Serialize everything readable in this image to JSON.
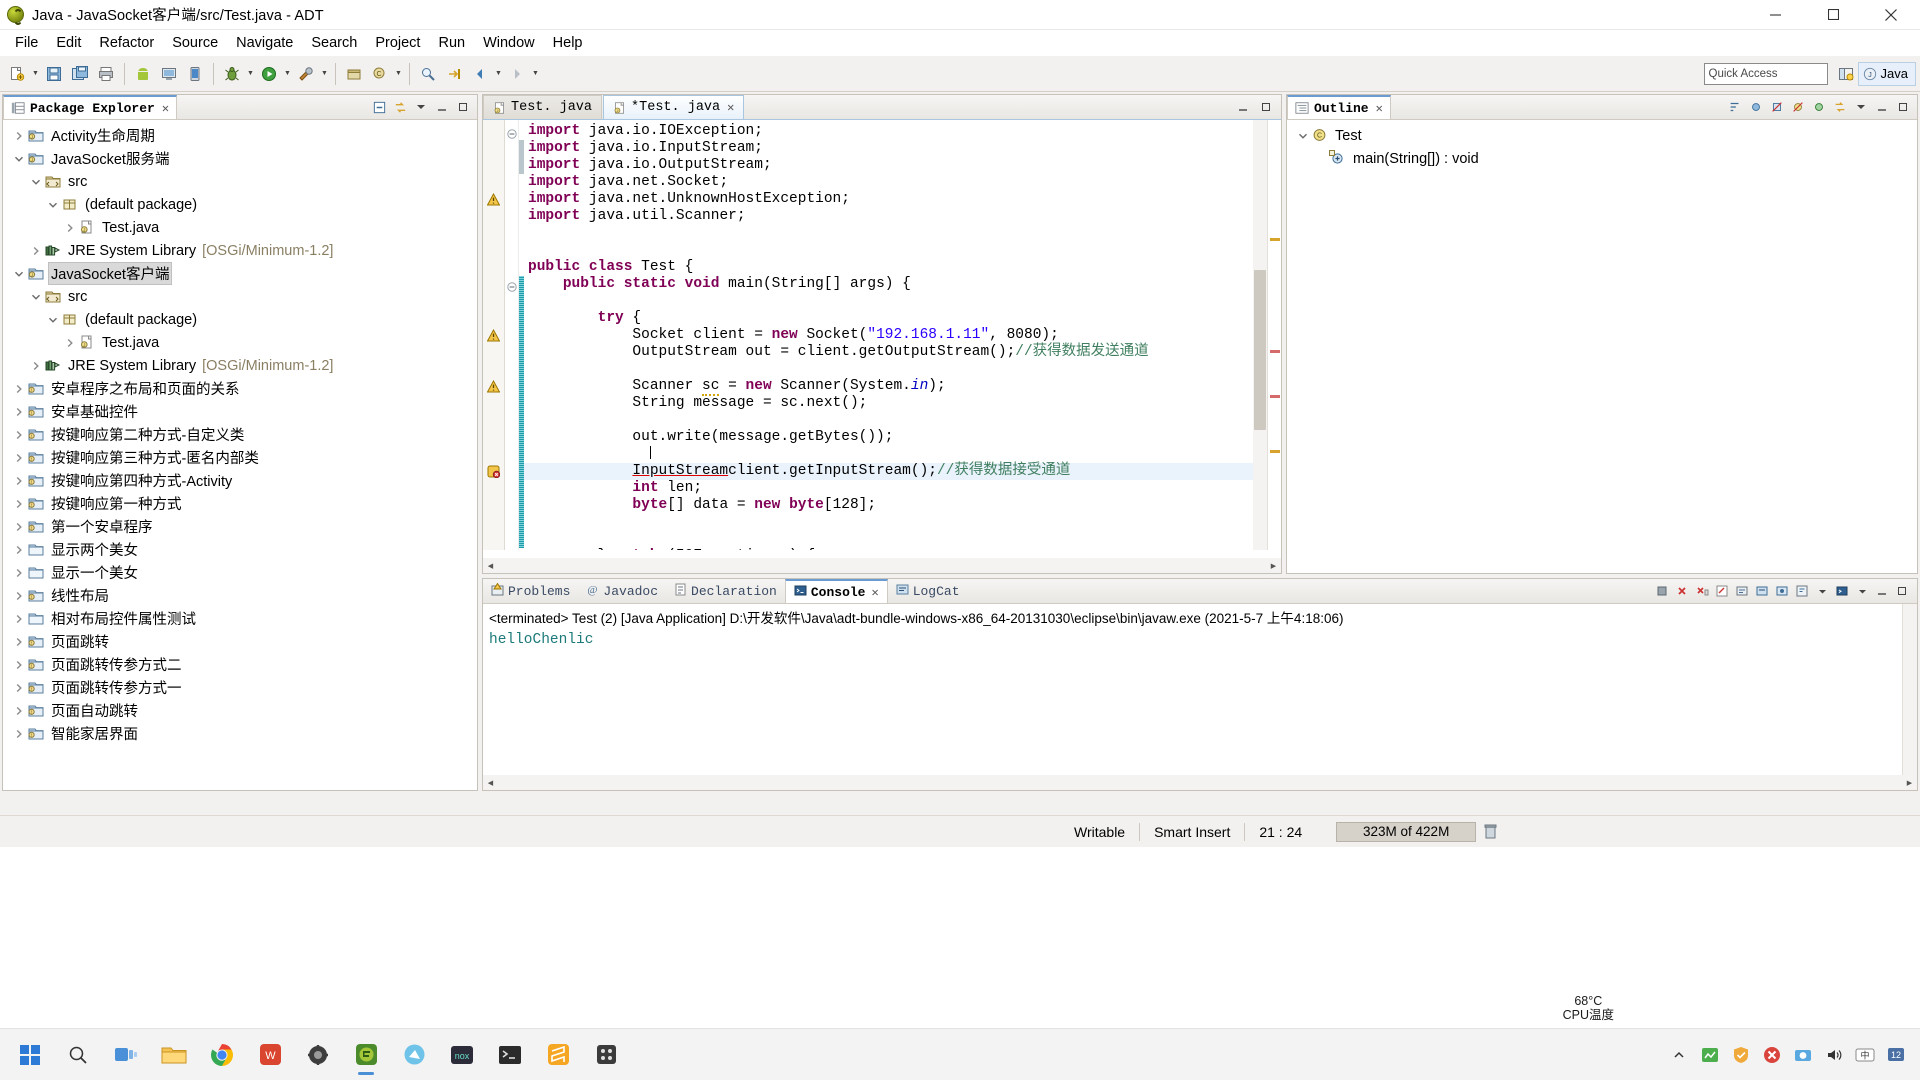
{
  "window": {
    "title": "Java - JavaSocket客户端/src/Test.java - ADT",
    "minimize_label": "Minimize",
    "maximize_label": "Maximize",
    "close_label": "Close"
  },
  "menubar": {
    "items": [
      {
        "label": "File"
      },
      {
        "label": "Edit"
      },
      {
        "label": "Refactor"
      },
      {
        "label": "Source"
      },
      {
        "label": "Navigate"
      },
      {
        "label": "Search"
      },
      {
        "label": "Project"
      },
      {
        "label": "Run"
      },
      {
        "label": "Window"
      },
      {
        "label": "Help"
      }
    ]
  },
  "toolbar": {
    "quick_access_placeholder": "Quick Access",
    "perspective_java_label": "Java"
  },
  "package_explorer": {
    "title": "Package Explorer",
    "close_glyph": "✕",
    "tree": [
      {
        "label": "Activity生命周期",
        "indent": 0,
        "twisty": "collapsed",
        "icon": "java-project-icon"
      },
      {
        "label": "JavaSocket服务端",
        "indent": 0,
        "twisty": "expanded",
        "icon": "java-project-icon"
      },
      {
        "label": "src",
        "indent": 1,
        "twisty": "expanded",
        "icon": "source-folder-icon"
      },
      {
        "label": "(default package)",
        "indent": 2,
        "twisty": "expanded",
        "icon": "package-icon"
      },
      {
        "label": "Test.java",
        "indent": 3,
        "twisty": "collapsed",
        "icon": "java-file-icon"
      },
      {
        "label": "JRE System Library",
        "suffix": "[OSGi/Minimum-1.2]",
        "indent": 1,
        "twisty": "collapsed",
        "icon": "library-icon"
      },
      {
        "label": "JavaSocket客户端",
        "indent": 0,
        "twisty": "expanded",
        "icon": "java-project-icon",
        "selected": true
      },
      {
        "label": "src",
        "indent": 1,
        "twisty": "expanded",
        "icon": "source-folder-icon"
      },
      {
        "label": "(default package)",
        "indent": 2,
        "twisty": "expanded",
        "icon": "package-icon"
      },
      {
        "label": "Test.java",
        "indent": 3,
        "twisty": "collapsed",
        "icon": "java-file-icon"
      },
      {
        "label": "JRE System Library",
        "suffix": "[OSGi/Minimum-1.2]",
        "indent": 1,
        "twisty": "collapsed",
        "icon": "library-icon"
      },
      {
        "label": "安卓程序之布局和页面的关系",
        "indent": 0,
        "twisty": "collapsed",
        "icon": "android-project-icon"
      },
      {
        "label": "安卓基础控件",
        "indent": 0,
        "twisty": "collapsed",
        "icon": "android-project-icon"
      },
      {
        "label": "按键响应第二种方式-自定义类",
        "indent": 0,
        "twisty": "collapsed",
        "icon": "android-project-icon"
      },
      {
        "label": "按键响应第三种方式-匿名内部类",
        "indent": 0,
        "twisty": "collapsed",
        "icon": "android-project-icon"
      },
      {
        "label": "按键响应第四种方式-Activity",
        "indent": 0,
        "twisty": "collapsed",
        "icon": "android-project-icon"
      },
      {
        "label": "按键响应第一种方式",
        "indent": 0,
        "twisty": "collapsed",
        "icon": "android-project-icon"
      },
      {
        "label": "第一个安卓程序",
        "indent": 0,
        "twisty": "collapsed",
        "icon": "android-project-icon"
      },
      {
        "label": "显示两个美女",
        "indent": 0,
        "twisty": "collapsed",
        "icon": "closed-project-icon"
      },
      {
        "label": "显示一个美女",
        "indent": 0,
        "twisty": "collapsed",
        "icon": "closed-project-icon"
      },
      {
        "label": "线性布局",
        "indent": 0,
        "twisty": "collapsed",
        "icon": "android-project-icon"
      },
      {
        "label": "相对布局控件属性测试",
        "indent": 0,
        "twisty": "collapsed",
        "icon": "closed-project-icon"
      },
      {
        "label": "页面跳转",
        "indent": 0,
        "twisty": "collapsed",
        "icon": "android-project-icon"
      },
      {
        "label": "页面跳转传参方式二",
        "indent": 0,
        "twisty": "collapsed",
        "icon": "android-project-icon"
      },
      {
        "label": "页面跳转传参方式一",
        "indent": 0,
        "twisty": "collapsed",
        "icon": "android-project-icon"
      },
      {
        "label": "页面自动跳转",
        "indent": 0,
        "twisty": "collapsed",
        "icon": "android-project-icon"
      },
      {
        "label": "智能家居界面",
        "indent": 0,
        "twisty": "collapsed",
        "icon": "android-project-icon"
      }
    ]
  },
  "editor": {
    "tabs": [
      {
        "label": "Test. java",
        "active": false,
        "dirty": false
      },
      {
        "label": "*Test. java",
        "active": true,
        "dirty": true,
        "close_glyph": "✕"
      }
    ],
    "code_lines": [
      {
        "text": "import java.io.IOException;",
        "fold": "start",
        "parts": [
          {
            "t": "import",
            "c": "kw"
          },
          {
            "t": " java.io.IOException;",
            "c": ""
          }
        ]
      },
      {
        "text": "import java.io.InputStream;",
        "parts": [
          {
            "t": "import",
            "c": "kw"
          },
          {
            "t": " java.io.InputStream;",
            "c": ""
          }
        ]
      },
      {
        "text": "import java.io.OutputStream;",
        "parts": [
          {
            "t": "import",
            "c": "kw"
          },
          {
            "t": " java.io.OutputStream;",
            "c": ""
          }
        ]
      },
      {
        "text": "import java.net.Socket;",
        "parts": [
          {
            "t": "import",
            "c": "kw"
          },
          {
            "t": " java.net.Socket;",
            "c": ""
          }
        ]
      },
      {
        "text": "import java.net.UnknownHostException;",
        "marker": "warning",
        "parts": [
          {
            "t": "import",
            "c": "kw"
          },
          {
            "t": " java.net.UnknownHostException;",
            "c": ""
          }
        ]
      },
      {
        "text": "import java.util.Scanner;",
        "parts": [
          {
            "t": "import",
            "c": "kw"
          },
          {
            "t": " java.util.Scanner;",
            "c": ""
          }
        ]
      },
      {
        "text": "",
        "parts": []
      },
      {
        "text": "",
        "parts": []
      },
      {
        "text": "public class Test {",
        "parts": [
          {
            "t": "public class",
            "c": "kw"
          },
          {
            "t": " Test {",
            "c": ""
          }
        ]
      },
      {
        "text": "    public static void main(String[] args) {",
        "fold": "start",
        "parts": [
          {
            "t": "    ",
            "c": ""
          },
          {
            "t": "public static void",
            "c": "kw"
          },
          {
            "t": " main(String[] args) {",
            "c": ""
          }
        ]
      },
      {
        "text": "",
        "parts": []
      },
      {
        "text": "        try {",
        "parts": [
          {
            "t": "        ",
            "c": ""
          },
          {
            "t": "try",
            "c": "kw"
          },
          {
            "t": " {",
            "c": ""
          }
        ]
      },
      {
        "text": "            Socket client = new Socket(\"192.168.1.11\", 8080);",
        "marker": "warning",
        "parts": [
          {
            "t": "            Socket client = ",
            "c": ""
          },
          {
            "t": "new",
            "c": "kw"
          },
          {
            "t": " Socket(",
            "c": ""
          },
          {
            "t": "\"192.168.1.11\"",
            "c": "str"
          },
          {
            "t": ", 8080);",
            "c": ""
          }
        ]
      },
      {
        "text": "            OutputStream out = client.getOutputStream();//获得数据发送通道",
        "parts": [
          {
            "t": "            OutputStream out = client.getOutputStream();",
            "c": ""
          },
          {
            "t": "//获得数据发送通道",
            "c": "cmt"
          }
        ]
      },
      {
        "text": "",
        "parts": []
      },
      {
        "text": "            Scanner sc = new Scanner(System.in);",
        "marker": "warning",
        "parts": [
          {
            "t": "            Scanner ",
            "c": ""
          },
          {
            "t": "sc",
            "c": "warnu"
          },
          {
            "t": " = ",
            "c": ""
          },
          {
            "t": "new",
            "c": "kw"
          },
          {
            "t": " Scanner(System.",
            "c": ""
          },
          {
            "t": "in",
            "c": "fld"
          },
          {
            "t": ");",
            "c": ""
          }
        ]
      },
      {
        "text": "            String message = sc.next();",
        "parts": [
          {
            "t": "            String message = sc.next();",
            "c": ""
          }
        ]
      },
      {
        "text": "",
        "parts": []
      },
      {
        "text": "            out.write(message.getBytes());",
        "parts": [
          {
            "t": "            out.write(message.getBytes());",
            "c": ""
          }
        ]
      },
      {
        "text": "",
        "parts": [],
        "caret_line": true
      },
      {
        "text": "            InputStreamclient.getInputStream();//获得数据接受通道",
        "marker": "error",
        "highlight": true,
        "parts": [
          {
            "t": "            ",
            "c": ""
          },
          {
            "t": "InputStream",
            "c": "erru"
          },
          {
            "t": "client.getInputStream();",
            "c": ""
          },
          {
            "t": "//获得数据接受通道",
            "c": "cmt"
          }
        ]
      },
      {
        "text": "            int len;",
        "parts": [
          {
            "t": "            ",
            "c": ""
          },
          {
            "t": "int",
            "c": "kw"
          },
          {
            "t": " len;",
            "c": ""
          }
        ]
      },
      {
        "text": "            byte[] data = new byte[128];",
        "parts": [
          {
            "t": "            ",
            "c": ""
          },
          {
            "t": "byte",
            "c": "kw"
          },
          {
            "t": "[] data = ",
            "c": ""
          },
          {
            "t": "new",
            "c": "kw"
          },
          {
            "t": " ",
            "c": ""
          },
          {
            "t": "byte",
            "c": "kw"
          },
          {
            "t": "[128];",
            "c": ""
          }
        ]
      },
      {
        "text": "",
        "parts": []
      },
      {
        "text": "",
        "parts": []
      },
      {
        "text": "        } catch (IOException e) {",
        "parts": [
          {
            "t": "        } ",
            "c": ""
          },
          {
            "t": "catch",
            "c": "kw"
          },
          {
            "t": " (IOException e) {",
            "c": ""
          }
        ]
      }
    ]
  },
  "outline": {
    "title": "Outline",
    "close_glyph": "✕",
    "tree": [
      {
        "label": "Test",
        "indent": 0,
        "twisty": "expanded",
        "icon": "class-icon"
      },
      {
        "label": "main(String[]) : void",
        "indent": 1,
        "twisty": "none",
        "icon": "method-static-icon"
      }
    ]
  },
  "console": {
    "tabs": [
      {
        "label": "Problems",
        "icon": "problems-icon",
        "active": false
      },
      {
        "label": "Javadoc",
        "icon": "javadoc-icon",
        "active": false
      },
      {
        "label": "Declaration",
        "icon": "declaration-icon",
        "active": false
      },
      {
        "label": "Console",
        "icon": "console-icon",
        "active": true,
        "close_glyph": "✕"
      },
      {
        "label": "LogCat",
        "icon": "logcat-icon",
        "active": false
      }
    ],
    "header": "<terminated> Test (2) [Java Application] D:\\开发软件\\Java\\adt-bundle-windows-x86_64-20131030\\eclipse\\bin\\javaw.exe (2021-5-7 上午4:18:06)",
    "output": "helloChenlic"
  },
  "statusbar": {
    "writable": "Writable",
    "insert_mode": "Smart Insert",
    "cursor_position": "21 : 24",
    "memory": "323M of 422M"
  },
  "taskbar": {
    "start_label": "start-icon",
    "search_label": "search-icon",
    "items": [
      {
        "name": "taskview-icon"
      },
      {
        "name": "file-explorer-icon"
      },
      {
        "name": "chrome-icon"
      },
      {
        "name": "wps-icon"
      },
      {
        "name": "tool-icon"
      },
      {
        "name": "eclipse-adt-icon",
        "active": true
      },
      {
        "name": "editor-icon"
      },
      {
        "name": "nox-player-icon"
      },
      {
        "name": "terminal-icon"
      },
      {
        "name": "sublime-icon"
      },
      {
        "name": "utility-icon"
      }
    ],
    "cpu_temp_value": "68°C",
    "cpu_temp_label": "CPU温度",
    "tray": [
      {
        "name": "show-hidden-icons-chevron"
      },
      {
        "name": "network-monitor-icon"
      },
      {
        "name": "security-shield-icon"
      },
      {
        "name": "antivirus-icon"
      },
      {
        "name": "screenshot-icon"
      },
      {
        "name": "volume-icon"
      },
      {
        "name": "input-method-icon"
      },
      {
        "name": "notification-icon"
      }
    ]
  }
}
